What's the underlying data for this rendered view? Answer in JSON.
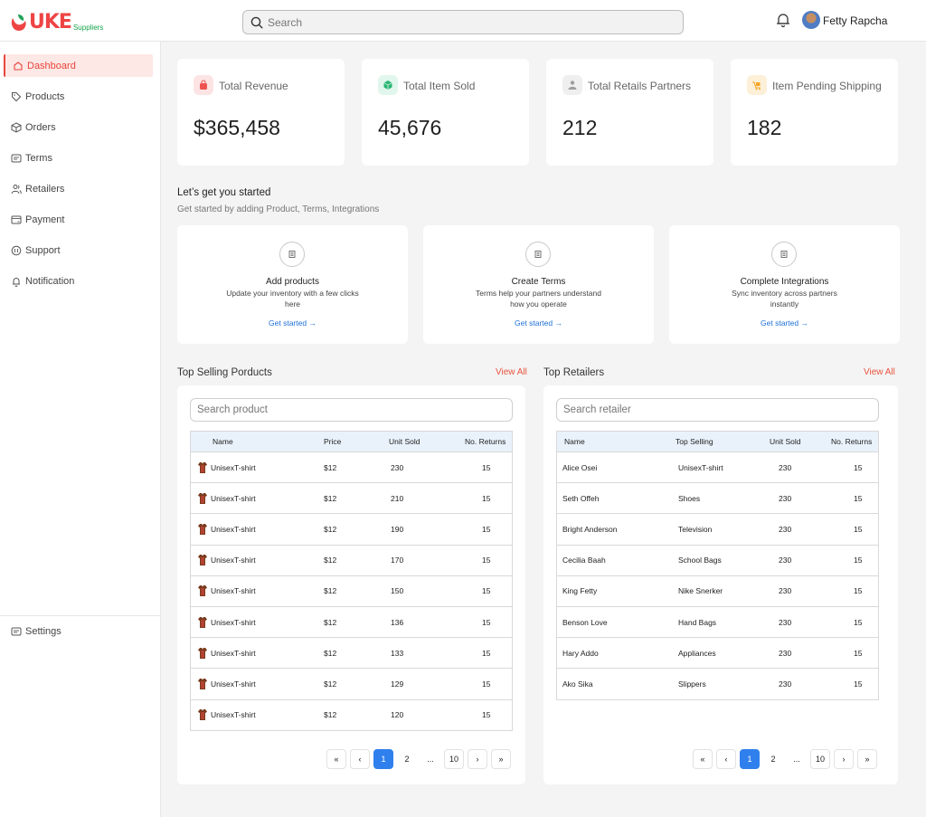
{
  "brand": {
    "name": "UKE",
    "sub": "Suppliers"
  },
  "header": {
    "search_placeholder": "Search",
    "user_name": "Fetty Rapcha"
  },
  "sidebar": {
    "items": [
      {
        "label": "Dashboard",
        "icon": "home-icon"
      },
      {
        "label": "Products",
        "icon": "tag-icon"
      },
      {
        "label": "Orders",
        "icon": "box-icon"
      },
      {
        "label": "Terms",
        "icon": "document-icon"
      },
      {
        "label": "Retailers",
        "icon": "users-icon"
      },
      {
        "label": "Payment",
        "icon": "payment-icon"
      },
      {
        "label": "Support",
        "icon": "support-icon"
      },
      {
        "label": "Notification",
        "icon": "bell-icon"
      }
    ],
    "active": "Dashboard",
    "settings_label": "Settings"
  },
  "stats": [
    {
      "label": "Total Revenue",
      "value": "$365,458",
      "icon": "bag-icon",
      "color": "#ef5350"
    },
    {
      "label": "Total Item Sold",
      "value": "45,676",
      "icon": "cube-icon",
      "color": "#2bb673"
    },
    {
      "label": "Total Retails Partners",
      "value": "212",
      "icon": "partners-icon",
      "color": "#9e9e9e"
    },
    {
      "label": "Item Pending Shipping",
      "value": "182",
      "icon": "shipping-icon",
      "color": "#f5a623"
    }
  ],
  "getting_started": {
    "title": "Let’s get you started",
    "subtitle": "Get started by adding Product, Terms, Integrations",
    "cards": [
      {
        "title": "Add products",
        "desc": "Update your inventory with a few clicks here",
        "link": "Get started"
      },
      {
        "title": "Create Terms",
        "desc": "Terms help your partners understand how you operate",
        "link": "Get started"
      },
      {
        "title": "Complete Integrations",
        "desc": "Sync inventory across partners instantly",
        "link": "Get started"
      }
    ]
  },
  "top_products": {
    "title": "Top Selling Porducts",
    "view_all": "View All",
    "search_placeholder": "Search product",
    "columns": [
      "Name",
      "Price",
      "Unit Sold",
      "No. Returns"
    ],
    "rows": [
      [
        "UnisexT-shirt",
        "$12",
        "230",
        "15"
      ],
      [
        "UnisexT-shirt",
        "$12",
        "210",
        "15"
      ],
      [
        "UnisexT-shirt",
        "$12",
        "190",
        "15"
      ],
      [
        "UnisexT-shirt",
        "$12",
        "170",
        "15"
      ],
      [
        "UnisexT-shirt",
        "$12",
        "150",
        "15"
      ],
      [
        "UnisexT-shirt",
        "$12",
        "136",
        "15"
      ],
      [
        "UnisexT-shirt",
        "$12",
        "133",
        "15"
      ],
      [
        "UnisexT-shirt",
        "$12",
        "129",
        "15"
      ],
      [
        "UnisexT-shirt",
        "$12",
        "120",
        "15"
      ]
    ]
  },
  "top_retailers": {
    "title": "Top Retailers",
    "view_all": "View All",
    "search_placeholder": "Search retailer",
    "columns": [
      "Name",
      "Top Selling",
      "Unit Sold",
      "No. Returns"
    ],
    "rows": [
      [
        "Alice Osei",
        "UnisexT-shirt",
        "230",
        "15"
      ],
      [
        "Seth Offeh",
        "Shoes",
        "230",
        "15"
      ],
      [
        "Bright Anderson",
        "Television",
        "230",
        "15"
      ],
      [
        "Cecilia Baah",
        "School Bags",
        "230",
        "15"
      ],
      [
        "King Fetty",
        "Nike Snerker",
        "230",
        "15"
      ],
      [
        "Benson Love",
        "Hand Bags",
        "230",
        "15"
      ],
      [
        "Hary Addo",
        "Appliances",
        "230",
        "15"
      ],
      [
        "Ako Sika",
        "Slippers",
        "230",
        "15"
      ]
    ]
  },
  "pagination": {
    "first": "«",
    "prev": "‹",
    "pages": [
      "1",
      "2",
      "...",
      "10"
    ],
    "current": "1",
    "next": "›",
    "last": "»"
  }
}
